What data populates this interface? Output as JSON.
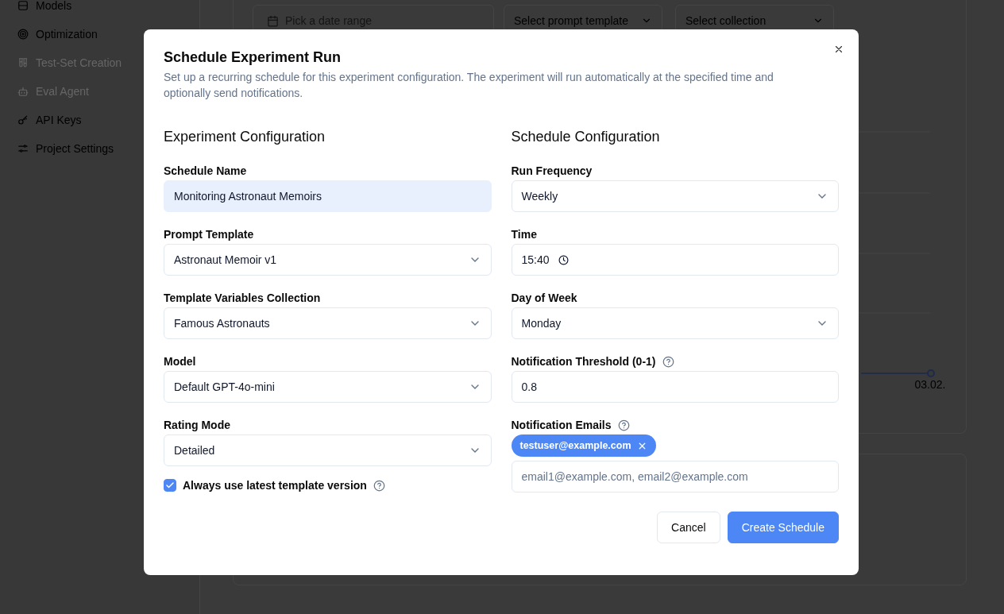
{
  "sidebar": {
    "items": [
      {
        "label": "Models",
        "disabled": false
      },
      {
        "label": "Optimization",
        "disabled": false
      },
      {
        "label": "Test-Set Creation",
        "disabled": true
      },
      {
        "label": "Eval Agent",
        "disabled": true
      },
      {
        "label": "API Keys",
        "disabled": false
      },
      {
        "label": "Project Settings",
        "disabled": false
      }
    ]
  },
  "filters": [
    {
      "kind": "date",
      "placeholder": "Pick a date range"
    },
    {
      "kind": "select",
      "value": "Select prompt template"
    },
    {
      "kind": "select",
      "value": "Select collection"
    }
  ],
  "chart": {
    "x_label": "03.02."
  },
  "dialog": {
    "title": "Schedule Experiment Run",
    "description": "Set up a recurring schedule for this experiment configuration. The experiment will run automatically at the specified time and optionally send notifications.",
    "columns": [
      {
        "heading": "Experiment Configuration",
        "fields": [
          {
            "kind": "text",
            "label": "Schedule Name",
            "value": "Monitoring Astronaut Memoirs",
            "autofilled": true
          },
          {
            "kind": "select",
            "label": "Prompt Template",
            "value": "Astronaut Memoir v1"
          },
          {
            "kind": "select",
            "label": "Template Variables Collection",
            "value": "Famous Astronauts"
          },
          {
            "kind": "select",
            "label": "Model",
            "value": "Default GPT-4o-mini"
          },
          {
            "kind": "select",
            "label": "Rating Mode",
            "value": "Detailed"
          },
          {
            "kind": "checkbox",
            "label": "Always use latest template version",
            "checked": true,
            "help": true
          }
        ]
      },
      {
        "heading": "Schedule Configuration",
        "fields": [
          {
            "kind": "select",
            "label": "Run Frequency",
            "value": "Weekly"
          },
          {
            "kind": "time",
            "label": "Time",
            "value": "15:40"
          },
          {
            "kind": "select",
            "label": "Day of Week",
            "value": "Monday"
          },
          {
            "kind": "text",
            "label": "Notification Threshold (0-1)",
            "value": "0.8",
            "autofilled": false,
            "help": true
          },
          {
            "kind": "tags",
            "label": "Notification Emails",
            "help": true,
            "tags": [
              "testuser@example.com"
            ],
            "placeholder": "email1@example.com, email2@example.com"
          }
        ]
      }
    ],
    "buttons": [
      {
        "label": "Cancel",
        "kind": "secondary"
      },
      {
        "label": "Create Schedule",
        "kind": "primary"
      }
    ]
  }
}
